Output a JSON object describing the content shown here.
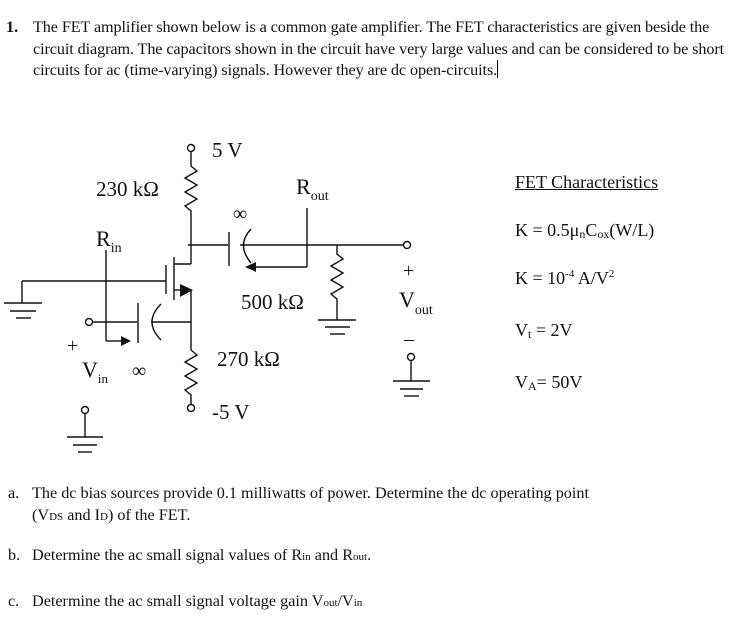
{
  "problem": {
    "number": "1.",
    "intro": "The FET amplifier shown below is a common gate amplifier. The FET characteristics are given beside the circuit diagram. The capacitors shown in the circuit have very large values and can be considered to be short circuits for ac (time-varying) signals. However they are dc open-circuits."
  },
  "circuit": {
    "supply_pos": "5 V",
    "supply_neg": "-5 V",
    "r_drain": "230 kΩ",
    "r_load": "500 kΩ",
    "r_source": "270 kΩ",
    "cap_value_symbol": "∞",
    "rin_label": "R",
    "rin_sub": "in",
    "rout_label": "R",
    "rout_sub": "out",
    "vin_label": "V",
    "vin_sub": "in",
    "vout_label": "V",
    "vout_sub": "out",
    "plus": "+",
    "minus": "–"
  },
  "fet_characteristics": {
    "title": "FET Characteristics",
    "k_formula": {
      "left": "K = 0.5μ",
      "n": "n",
      "c": "C",
      "ox": "ox",
      "tail": "(W/L)"
    },
    "k_value": {
      "left": "K = 10",
      "exp": "-4",
      "mid": " A/V",
      "exp2": "2"
    },
    "vt": {
      "v": "V",
      "sub": "t",
      "rest": " = 2V"
    },
    "va": {
      "v": "V",
      "sub": "A",
      "rest": "= 50V"
    }
  },
  "questions": [
    {
      "letter": "a.",
      "line1": "The dc bias sources provide 0.1 milliwatts of  power. Determine the dc operating point",
      "line2_pre": "(V",
      "line2_sub1": "DS",
      "line2_mid": " and I",
      "line2_sub2": "D",
      "line2_post": ") of the FET."
    },
    {
      "letter": "b.",
      "pre": "Determine the ac small signal values of R",
      "sub1": "in",
      "mid": " and R",
      "sub2": "out",
      "post": "."
    },
    {
      "letter": "c.",
      "pre": "Determine the ac small signal voltage gain V",
      "sub1": "out",
      "mid": "/V",
      "sub2": "in"
    }
  ]
}
